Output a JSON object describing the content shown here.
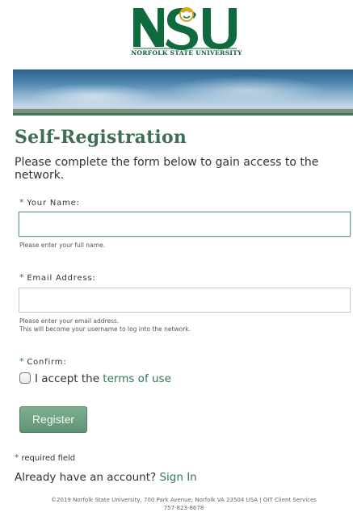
{
  "header": {
    "logo_letters": "NSU",
    "logo_subtitle": "NORFOLK STATE UNIVERSITY",
    "brand_color": "#0d6b3d",
    "accent_color": "#d7a521"
  },
  "form": {
    "title": "Self-Registration",
    "intro": "Please complete the form below to gain access to the network.",
    "required_mark": "*",
    "name_label": "Your Name:",
    "name_value": "",
    "name_help": "Please enter your full name.",
    "email_label": "Email Address:",
    "email_value": "",
    "email_help_line1": "Please enter your email address.",
    "email_help_line2": "This will become your username to log into the network.",
    "confirm_label": "Confirm:",
    "accept_prefix": "I accept the ",
    "terms_link": "terms of use",
    "register_label": "Register",
    "required_note": "required field",
    "account_prompt": "Already have an account? ",
    "signin_link": "Sign In"
  },
  "footer": {
    "line1": "©2019 Norfolk State University, 700 Park Avenue, Norfolk VA 23504 USA | OIT Client Services",
    "line2": "757-823-8678"
  }
}
